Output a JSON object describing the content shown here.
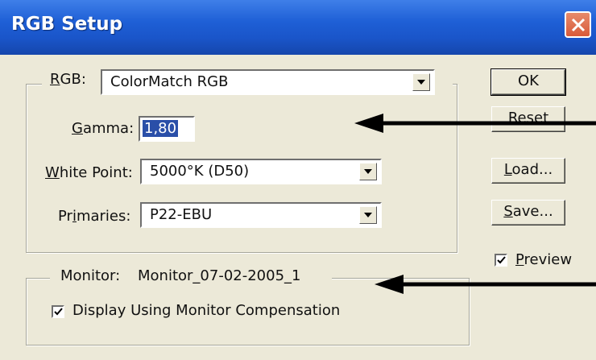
{
  "window": {
    "title": "RGB Setup"
  },
  "rgb": {
    "label": "RGB:",
    "value": "ColorMatch RGB"
  },
  "gamma": {
    "label": "Gamma:",
    "value": "1,80"
  },
  "white_point": {
    "label": "White Point:",
    "value": "5000°K (D50)"
  },
  "primaries": {
    "label": "Primaries:",
    "value": "P22-EBU"
  },
  "buttons": {
    "ok": "OK",
    "reset": "Reset",
    "load": "Load...",
    "save": "Save..."
  },
  "preview": {
    "label": "Preview",
    "checked": true
  },
  "monitor": {
    "label": "Monitor:",
    "value": "Monitor_07-02-2005_1"
  },
  "compensation": {
    "label": "Display Using Monitor Compensation",
    "checked": true
  }
}
